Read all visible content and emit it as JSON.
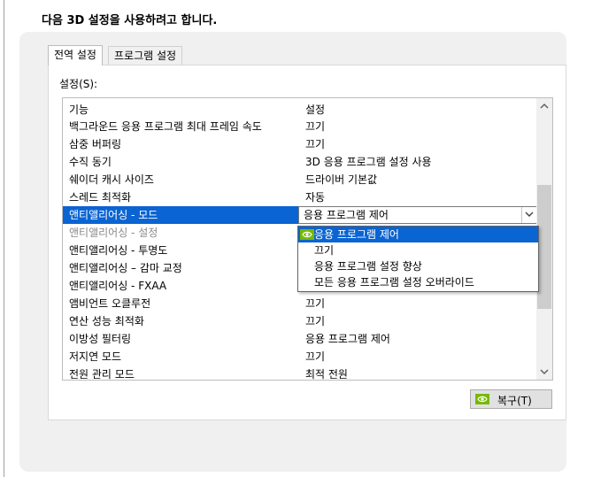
{
  "page": {
    "heading": "다음 3D 설정을 사용하려고 합니다."
  },
  "tabs": [
    {
      "label": "전역 설정",
      "active": true
    },
    {
      "label": "프로그램 설정",
      "active": false
    }
  ],
  "settings_label": "설정(S):",
  "table": {
    "headers": {
      "feature": "기능",
      "setting": "설정"
    },
    "rows": [
      {
        "feature": "백그라운드 응용 프로그램 최대 프레임 속도",
        "setting": "끄기"
      },
      {
        "feature": "삼중 버퍼링",
        "setting": "끄기"
      },
      {
        "feature": "수직 동기",
        "setting": "3D 응용 프로그램 설정 사용"
      },
      {
        "feature": "쉐이더 캐시 사이즈",
        "setting": "드라이버 기본값"
      },
      {
        "feature": "스레드 최적화",
        "setting": "자동"
      },
      {
        "feature": "앤티앨리어싱 - 모드",
        "setting": "응용 프로그램 제어",
        "selected": true
      },
      {
        "feature": "앤티앨리어싱 - 설정",
        "setting": "",
        "disabled": true
      },
      {
        "feature": "앤티앨리어싱 - 투명도",
        "setting": ""
      },
      {
        "feature": "앤티앨리어싱 – 감마 교정",
        "setting": ""
      },
      {
        "feature": "앤티앨리어싱 - FXAA",
        "setting": ""
      },
      {
        "feature": "앰비언트 오클루전",
        "setting": "끄기"
      },
      {
        "feature": "연산 성능 최적화",
        "setting": "끄기"
      },
      {
        "feature": "이방성 필터링",
        "setting": "응용 프로그램 제어"
      },
      {
        "feature": "저지연 모드",
        "setting": "끄기"
      },
      {
        "feature": "전원 관리 모드",
        "setting": "최적 전원"
      }
    ]
  },
  "dropdown": {
    "options": [
      {
        "label": "응용 프로그램 제어",
        "highlighted": true,
        "icon": "nvidia-icon"
      },
      {
        "label": "끄기"
      },
      {
        "label": "응용 프로그램 설정 향상"
      },
      {
        "label": "모든 응용 프로그램 설정 오버라이드"
      }
    ]
  },
  "restore_button": {
    "label": "복구(T)",
    "icon": "nvidia-icon"
  },
  "colors": {
    "selection": "#0a64d2",
    "nvidia_green": "#76b900",
    "panel": "#f0f0f0"
  }
}
